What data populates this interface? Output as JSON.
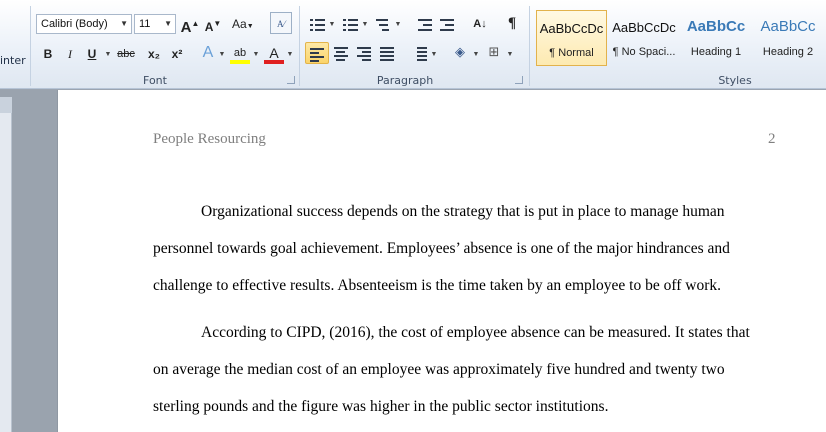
{
  "ribbon": {
    "clipboard_stub": "inter",
    "font": {
      "group_label": "Font",
      "font_name": "Calibri (Body)",
      "font_size": "11",
      "grow_label": "A",
      "shrink_label": "A",
      "case_label": "Aa",
      "bold": "B",
      "italic": "I",
      "underline": "U",
      "strike": "abc",
      "subscript": "x₂",
      "superscript": "x²",
      "effects_label": "A",
      "highlight_label": "ab",
      "color_label": "A"
    },
    "paragraph": {
      "group_label": "Paragraph",
      "show_marks": "¶"
    },
    "styles": {
      "group_label": "Styles",
      "items": [
        {
          "sample": "AaBbCcDc",
          "name": "¶ Normal"
        },
        {
          "sample": "AaBbCcDc",
          "name": "¶ No Spaci..."
        },
        {
          "sample": "AaBbCc",
          "name": "Heading 1"
        },
        {
          "sample": "AaBbCc",
          "name": "Heading 2"
        }
      ]
    }
  },
  "document": {
    "header_left": "People Resourcing",
    "page_number": "2",
    "lines": [
      "Organizational success depends on the strategy that is put in place to manage human",
      "personnel towards goal achievement. Employees’ absence is one of the major hindrances and",
      "challenge to effective results. Absenteeism is the time taken by an employee to be off work.",
      "According to CIPD, (2016), the cost of employee absence can be measured. It states that",
      "on average the median cost of an employee was approximately five hundred and twenty two",
      "sterling pounds and the figure was higher in the public sector institutions."
    ]
  }
}
